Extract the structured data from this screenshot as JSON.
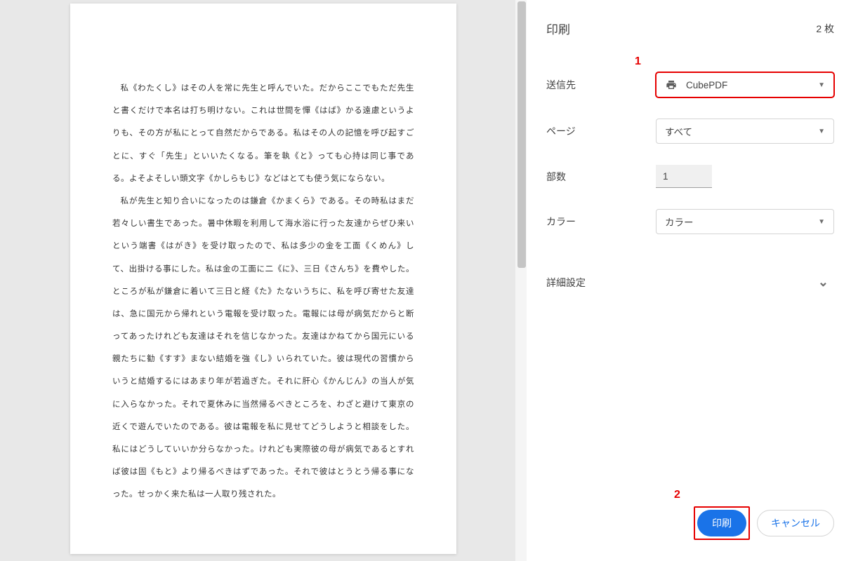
{
  "panel": {
    "title": "印刷",
    "page_count": "2 枚"
  },
  "settings": {
    "destination": {
      "label": "送信先",
      "value": "CubePDF"
    },
    "pages": {
      "label": "ページ",
      "value": "すべて"
    },
    "copies": {
      "label": "部数",
      "value": "1"
    },
    "color": {
      "label": "カラー",
      "value": "カラー"
    },
    "more": {
      "label": "詳細設定"
    }
  },
  "annotations": {
    "num1": "1",
    "num2": "2"
  },
  "footer": {
    "print": "印刷",
    "cancel": "キャンセル"
  },
  "document": {
    "paragraph1": "私《わたくし》はその人を常に先生と呼んでいた。だからここでもただ先生と書くだけで本名は打ち明けない。これは世間を憚《はば》かる遠慮というよりも、その方が私にとって自然だからである。私はその人の記憶を呼び起すごとに、すぐ「先生」といいたくなる。筆を執《と》っても心持は同じ事である。よそよそしい頭文字《かしらもじ》などはとても使う気にならない。",
    "paragraph2": "私が先生と知り合いになったのは鎌倉《かまくら》である。その時私はまだ若々しい書生であった。暑中休暇を利用して海水浴に行った友達からぜひ来いという端書《はがき》を受け取ったので、私は多少の金を工面《くめん》して、出掛ける事にした。私は金の工面に二《に》、三日《さんち》を費やした。ところが私が鎌倉に着いて三日と経《た》たないうちに、私を呼び寄せた友達は、急に国元から帰れという電報を受け取った。電報には母が病気だからと断ってあったけれども友達はそれを信じなかった。友達はかねてから国元にいる親たちに勧《すす》まない結婚を強《し》いられていた。彼は現代の習慣からいうと結婚するにはあまり年が若過ぎた。それに肝心《かんじん》の当人が気に入らなかった。それで夏休みに当然帰るべきところを、わざと避けて東京の近くで遊んでいたのである。彼は電報を私に見せてどうしようと相談をした。私にはどうしていいか分らなかった。けれども実際彼の母が病気であるとすれば彼は固《もと》より帰るべきはずであった。それで彼はとうとう帰る事になった。せっかく来た私は一人取り残された。"
  }
}
